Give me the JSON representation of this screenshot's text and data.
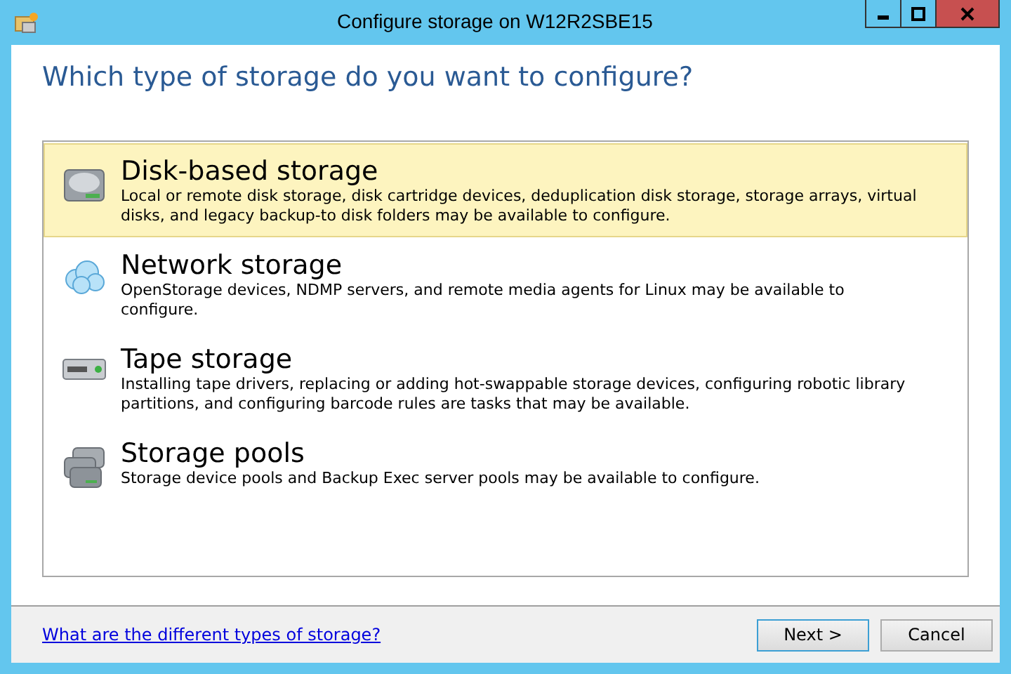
{
  "window": {
    "title": "Configure storage on W12R2SBE15"
  },
  "heading": "Which type of storage do you want to configure?",
  "options": [
    {
      "kind": "disk",
      "title": "Disk-based storage",
      "description": "Local or remote disk storage, disk cartridge devices, deduplication disk storage, storage arrays, virtual disks, and legacy backup-to disk folders may be available to configure.",
      "selected": true
    },
    {
      "kind": "network",
      "title": "Network storage",
      "description": "OpenStorage devices, NDMP servers, and remote media agents for Linux may be available to configure.",
      "selected": false
    },
    {
      "kind": "tape",
      "title": "Tape storage",
      "description": "Installing tape drivers, replacing or adding hot-swappable storage devices, configuring robotic library partitions, and configuring barcode rules are tasks that may be available.",
      "selected": false
    },
    {
      "kind": "pools",
      "title": "Storage pools",
      "description": "Storage device pools and Backup Exec server pools may be available to configure.",
      "selected": false
    }
  ],
  "help_link": "What are the different types of storage?",
  "buttons": [
    {
      "label": "Next >",
      "selected": true
    },
    {
      "label": "Cancel",
      "selected": false
    }
  ]
}
